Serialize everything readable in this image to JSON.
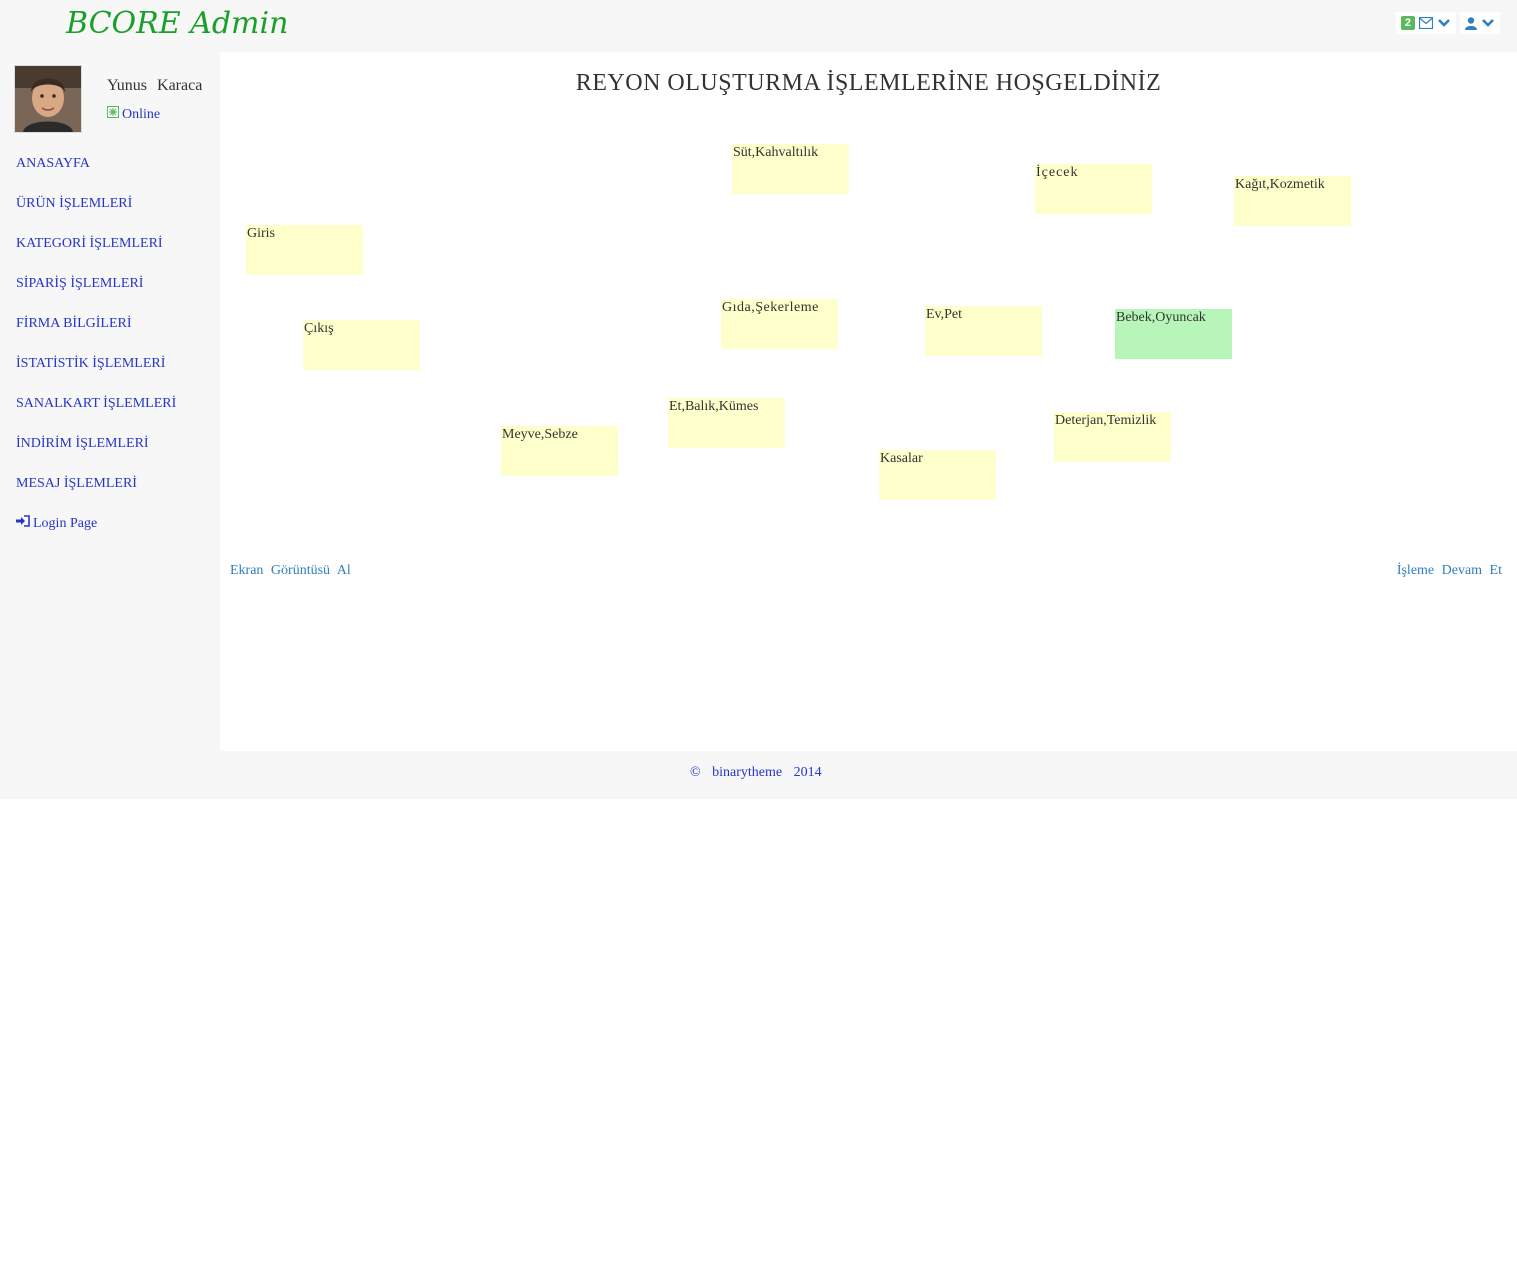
{
  "header": {
    "brand": "BCORE Admin",
    "message_count": "2"
  },
  "user": {
    "name": "Yunus  Karaca",
    "status": "Online"
  },
  "nav": {
    "items": [
      "ANASAYFA",
      "ÜRÜN İŞLEMLERİ",
      "KATEGORİ İŞLEMLERİ",
      "SİPARİŞ İŞLEMLERİ",
      "FİRMA BİLGİLERİ",
      "İSTATİSTİK İŞLEMLERİ",
      "SANALKART İŞLEMLERİ",
      "İNDİRİM İŞLEMLERİ",
      "MESAJ İŞLEMLERİ"
    ],
    "login": "Login Page"
  },
  "main": {
    "title": "REYON OLUŞTURMA İŞLEMLERİNE HOŞGELDİNİZ",
    "shelves": [
      "Süt,Kahvaltılık",
      "İçecek",
      "Kağıt,Kozmetik",
      "Giris",
      "Çıkış",
      "Gıda,Şekerleme",
      "Ev,Pet",
      "Bebek,Oyuncak",
      "Et,Balık,Kümes",
      "Meyve,Sebze",
      "Deterjan,Temizlik",
      "Kasalar"
    ],
    "screenshot_link": "Ekran Görüntüsü Al",
    "continue_link": "İşleme Devam Et"
  },
  "footer": {
    "text": "© binarytheme 2014"
  },
  "colors": {
    "brand": "#1aa02a",
    "nav_link": "#2635c9",
    "shelf": "#ffffcc",
    "shelf_active": "#b8f5b8",
    "badge": "#5cb85c"
  }
}
